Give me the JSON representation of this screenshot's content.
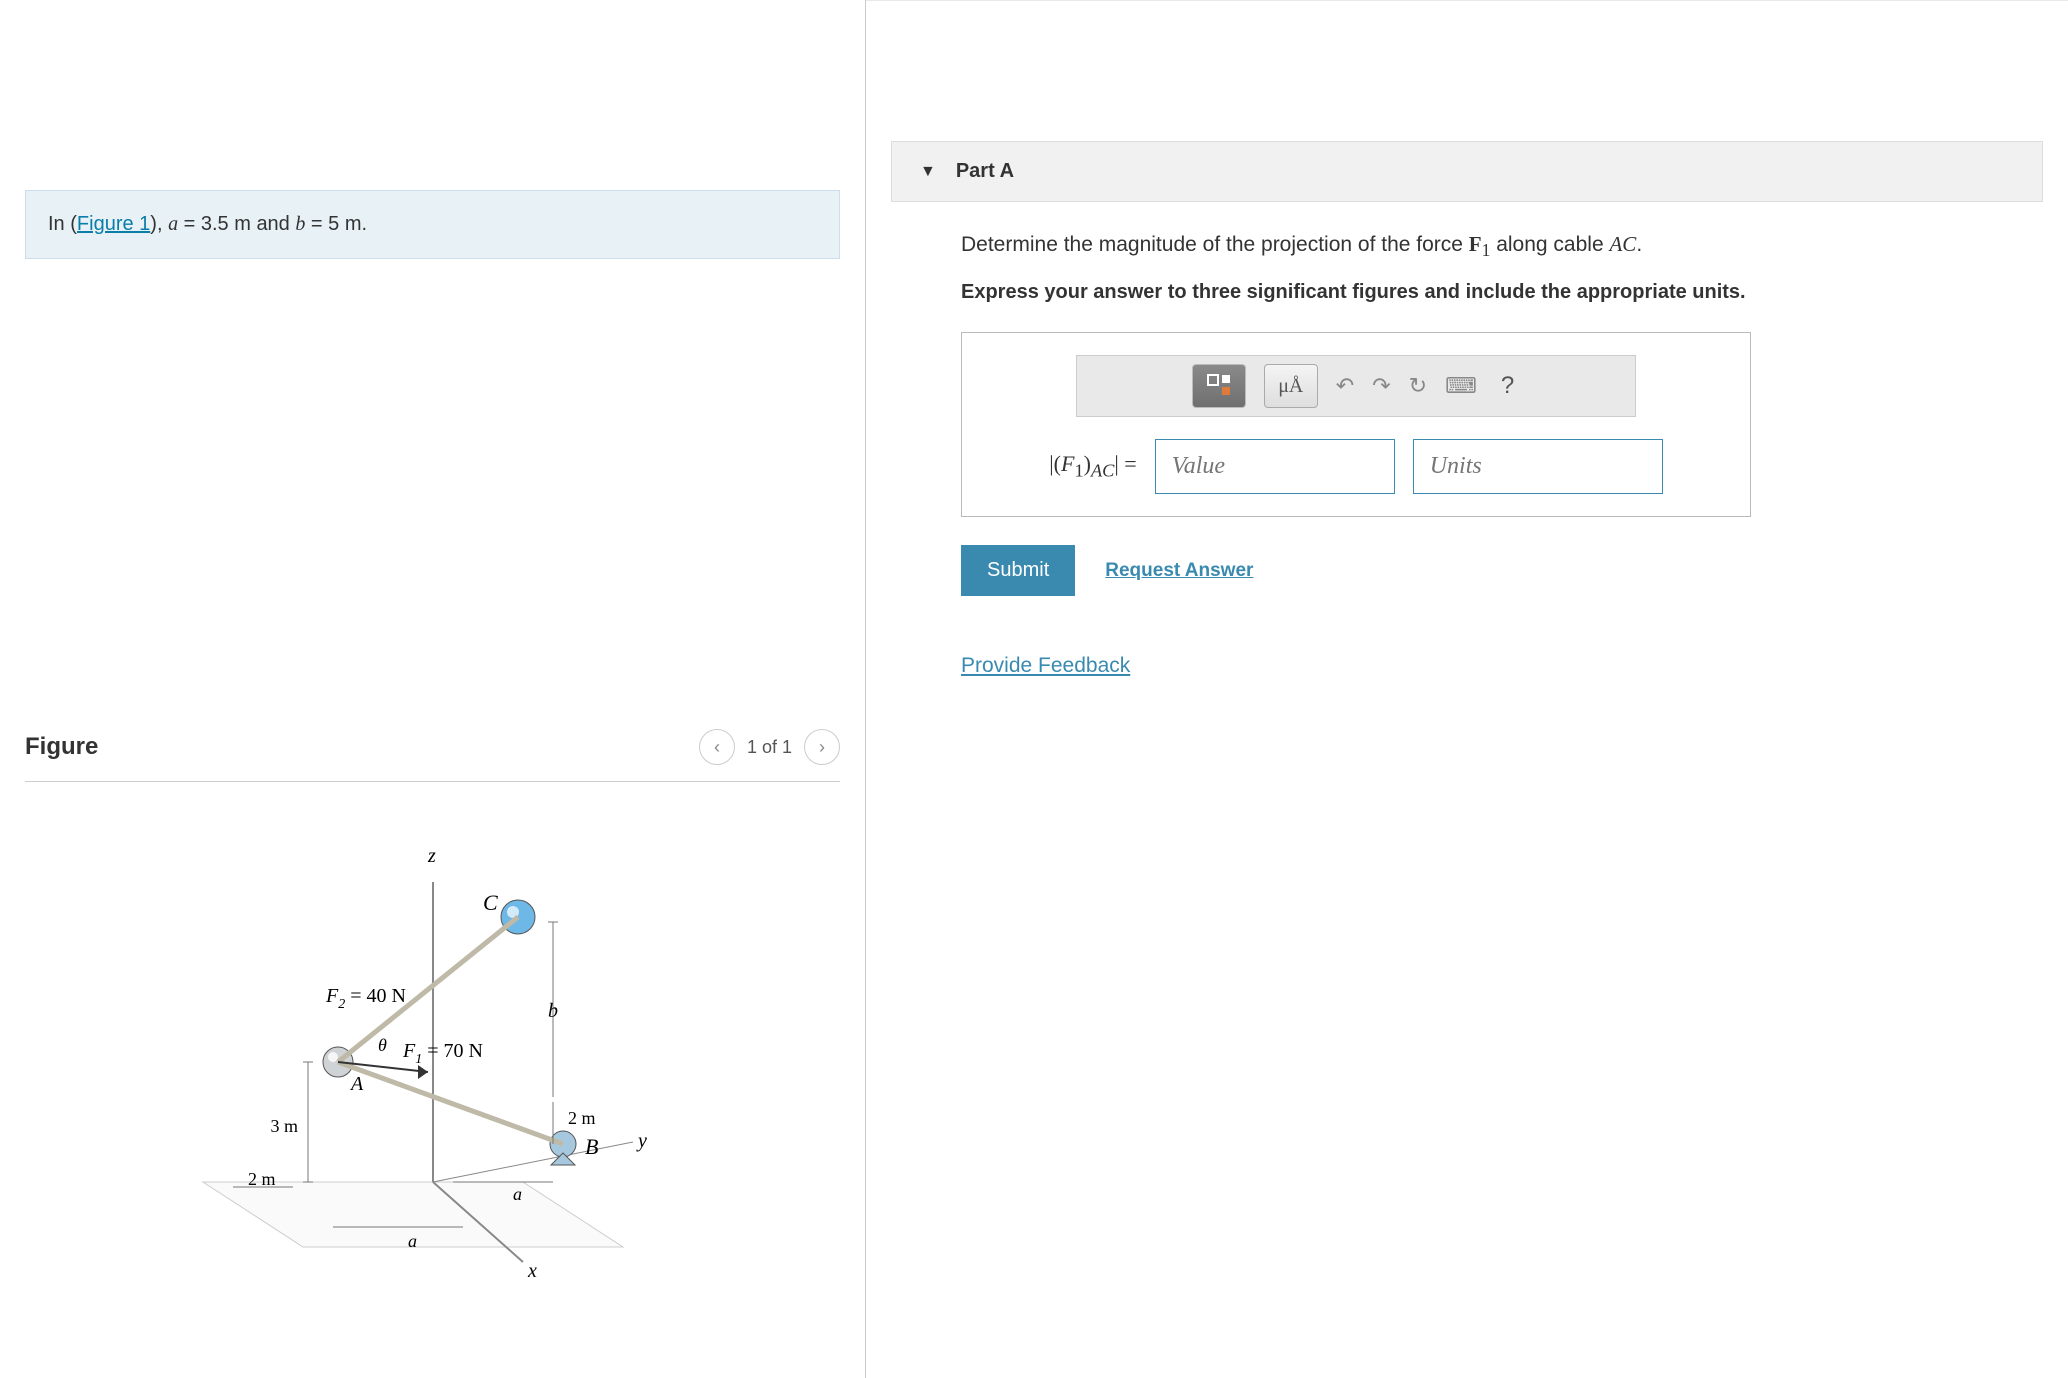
{
  "problem": {
    "pre_text": "In (",
    "fig_link": "Figure 1",
    "post_text": "), ",
    "a_var": "a",
    "a_val": " = 3.5 m ",
    "and_text": "and ",
    "b_var": "b",
    "b_val": " = 5 m."
  },
  "figure": {
    "title": "Figure",
    "nav_label": "1 of 1",
    "labels": {
      "z": "z",
      "c": "C",
      "f2": "F",
      "f2sub": "2",
      "f2eq": " = 40 N",
      "b": "b",
      "theta": "θ",
      "a_pt": "A",
      "f1": "F",
      "f1sub": "1",
      "f1eq": " = 70 N",
      "m3": "3 m",
      "m2a": "2 m",
      "m2b": "2 m",
      "y": "y",
      "b_pt": "B",
      "a_dim1": "a",
      "a_dim2": "a",
      "x": "x"
    }
  },
  "partA": {
    "title": "Part A",
    "question_pre": "Determine the magnitude of the projection of the force ",
    "f1_sym": "F",
    "f1_sub": "1",
    "question_mid": " along cable ",
    "ac_sym": "AC",
    "question_end": ".",
    "instruction": "Express your answer to three significant figures and include the appropriate units.",
    "toolbar_mu": "μÅ",
    "label_pre": "|(",
    "label_f": "F",
    "label_sub": "1",
    "label_close": ")",
    "label_ac": "AC",
    "label_post": "| = ",
    "value_ph": "Value",
    "units_ph": "Units",
    "submit": "Submit",
    "request": "Request Answer"
  },
  "feedback": "Provide Feedback"
}
